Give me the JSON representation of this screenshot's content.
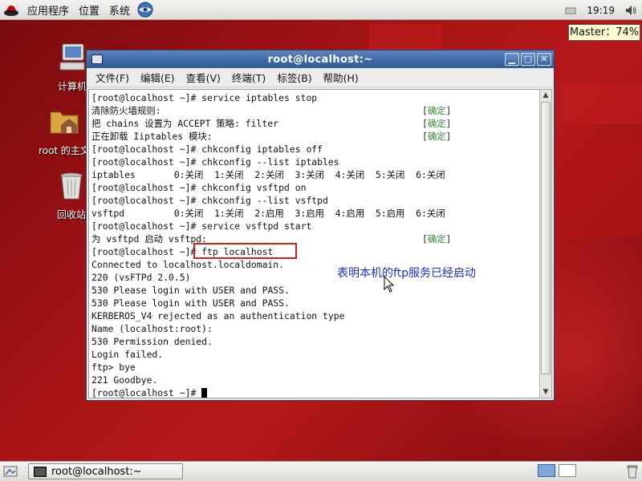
{
  "top_panel": {
    "menus": [
      "应用程序",
      "位置",
      "系统"
    ],
    "clock": "19:19"
  },
  "master_indicator": "Master：74%",
  "desktop_icons": [
    {
      "name": "computer",
      "label": "计算机"
    },
    {
      "name": "home-folder",
      "label": "root 的主文"
    },
    {
      "name": "trash",
      "label": "回收站"
    }
  ],
  "window": {
    "title": "root@localhost:~",
    "menu": [
      "文件(F)",
      "编辑(E)",
      "查看(V)",
      "终端(T)",
      "标签(B)",
      "帮助(H)"
    ],
    "terminal_lines": [
      {
        "text": "[root@localhost ~]# service iptables stop",
        "status": ""
      },
      {
        "text": "清除防火墙规则:",
        "status": "确定"
      },
      {
        "text": "把 chains 设置为 ACCEPT 策略: filter",
        "status": "确定"
      },
      {
        "text": "正在卸载 Iiptables 模块:",
        "status": "确定"
      },
      {
        "text": "[root@localhost ~]# chkconfig iptables off",
        "status": ""
      },
      {
        "text": "[root@localhost ~]# chkconfig --list iptables",
        "status": ""
      },
      {
        "text": "iptables       0:关闭  1:关闭  2:关闭  3:关闭  4:关闭  5:关闭  6:关闭",
        "status": ""
      },
      {
        "text": "[root@localhost ~]# chkconfig vsftpd on",
        "status": ""
      },
      {
        "text": "[root@localhost ~]# chkconfig --list vsftpd",
        "status": ""
      },
      {
        "text": "vsftpd         0:关闭  1:关闭  2:启用  3:启用  4:启用  5:启用  6:关闭",
        "status": ""
      },
      {
        "text": "[root@localhost ~]# service vsftpd start",
        "status": ""
      },
      {
        "text": "为 vsftpd 启动 vsftpd:",
        "status": "确定"
      },
      {
        "text": "[root@localhost ~]# ftp localhost",
        "status": ""
      },
      {
        "text": "Connected to localhost.localdomain.",
        "status": ""
      },
      {
        "text": "220 (vsFTPd 2.0.5)",
        "status": ""
      },
      {
        "text": "530 Please login with USER and PASS.",
        "status": ""
      },
      {
        "text": "530 Please login with USER and PASS.",
        "status": ""
      },
      {
        "text": "KERBEROS_V4 rejected as an authentication type",
        "status": ""
      },
      {
        "text": "Name (localhost:root):",
        "status": ""
      },
      {
        "text": "530 Permission denied.",
        "status": ""
      },
      {
        "text": "Login failed.",
        "status": ""
      },
      {
        "text": "ftp> bye",
        "status": ""
      },
      {
        "text": "221 Goodbye.",
        "status": ""
      }
    ],
    "prompt": "[root@localhost ~]# "
  },
  "annotation": "表明本机的ftp服务已经启动",
  "taskbar": {
    "task_label": "root@localhost:~"
  },
  "colors": {
    "desktop": "#a81416",
    "titlebar": "#3e6aa8",
    "ok_green": "#3d8f3d",
    "highlight": "#d41e1e",
    "annotation": "#1c2fd0"
  }
}
